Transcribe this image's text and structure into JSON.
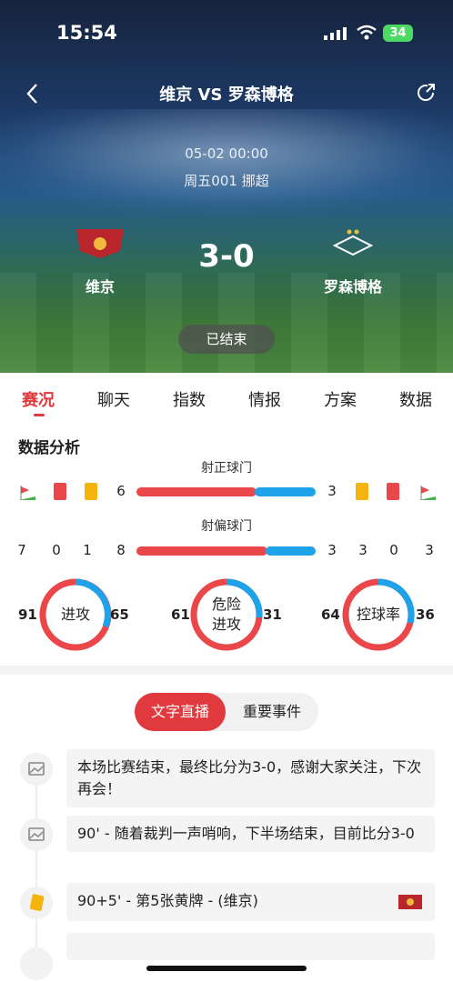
{
  "status": {
    "time": "15:54",
    "battery": "34"
  },
  "nav": {
    "title": "维京 VS 罗森博格"
  },
  "match": {
    "datetime": "05-02 00:00",
    "league": "周五001 挪超",
    "home": "维京",
    "away": "罗森博格",
    "score": "3-0",
    "status": "已结束"
  },
  "tabs": [
    "赛况",
    "聊天",
    "指数",
    "情报",
    "方案",
    "数据"
  ],
  "stats": {
    "title": "数据分析",
    "shots_on_label": "射正球门",
    "shots_on": {
      "home": "6",
      "away": "3"
    },
    "shots_off_label": "射偏球门",
    "row2_home": [
      "7",
      "0",
      "1",
      "8"
    ],
    "row2_away": [
      "3",
      "3",
      "0",
      "3"
    ],
    "colors": {
      "home": "#e9474a",
      "away": "#1ea3ea"
    },
    "donuts": [
      {
        "label": "进攻",
        "home": "91",
        "away": "65"
      },
      {
        "label": "危险\n进攻",
        "label_line1": "危险",
        "label_line2": "进攻",
        "home": "61",
        "away": "31"
      },
      {
        "label": "控球率",
        "home": "64",
        "away": "36"
      }
    ]
  },
  "live": {
    "toggle_on": "文字直播",
    "toggle_off": "重要事件",
    "events": [
      {
        "text": "本场比赛结束，最终比分为3-0，感谢大家关注，下次再会！"
      },
      {
        "text": "90' - 随着裁判一声哨响，下半场结束，目前比分3-0"
      },
      {
        "text": "90+5' - 第5张黄牌 - (维京)"
      }
    ]
  }
}
